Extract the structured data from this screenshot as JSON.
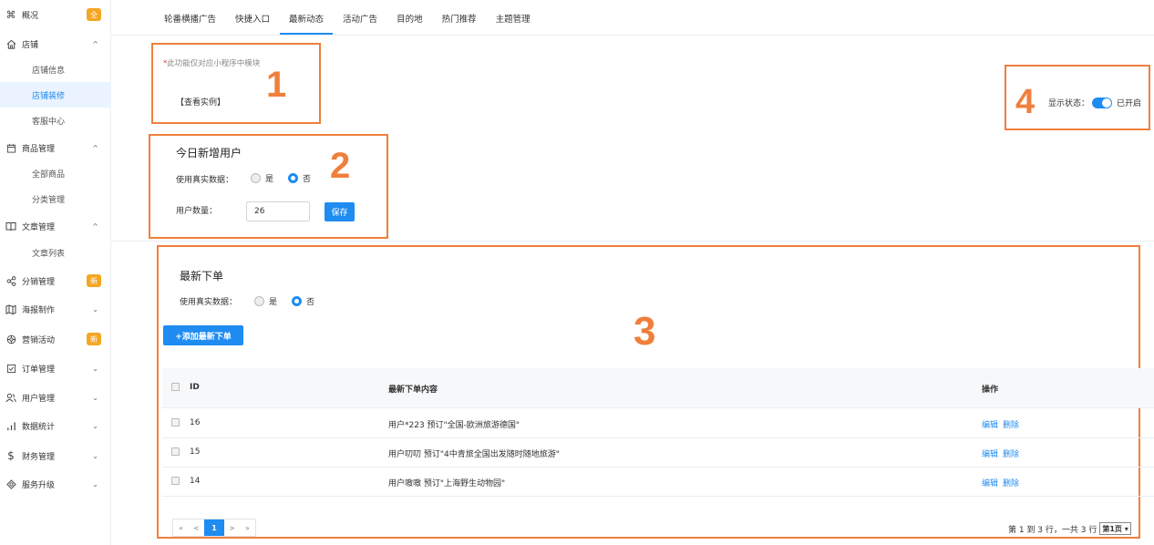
{
  "sidebar": {
    "items": [
      {
        "label": "概况",
        "badge": "全"
      },
      {
        "label": "店铺"
      },
      {
        "label": "商品管理"
      },
      {
        "label": "文章管理"
      },
      {
        "label": "分销管理",
        "badge": "新"
      },
      {
        "label": "海报制作"
      },
      {
        "label": "营销活动",
        "badge": "新"
      },
      {
        "label": "订单管理"
      },
      {
        "label": "用户管理"
      },
      {
        "label": "数据统计"
      },
      {
        "label": "财务管理"
      },
      {
        "label": "服务升级"
      }
    ],
    "sub_shop": [
      "店铺信息",
      "店铺装修",
      "客服中心"
    ],
    "sub_goods": [
      "全部商品",
      "分类管理"
    ],
    "sub_article": [
      "文章列表"
    ]
  },
  "tabs": [
    "轮番横播广告",
    "快捷入口",
    "最新动态",
    "活动广告",
    "目的地",
    "热门推荐",
    "主题管理"
  ],
  "notice": {
    "star": "*",
    "text": "此功能仅对应小程序中模块",
    "example": "【查看实例】"
  },
  "status": {
    "label": "显示状态：",
    "value": "已开启"
  },
  "annotations": [
    "1",
    "2",
    "3",
    "4"
  ],
  "new_users": {
    "title": "今日新增用户",
    "real_label": "使用真实数据：",
    "yes": "是",
    "no": "否",
    "count_label": "用户数量：",
    "count_value": "26",
    "save": "保存"
  },
  "latest_orders": {
    "title": "最新下单",
    "real_label": "使用真实数据：",
    "yes": "是",
    "no": "否",
    "add_button": "+添加最新下单",
    "columns": [
      "ID",
      "最新下单内容",
      "操作"
    ],
    "rows": [
      {
        "id": "16",
        "content": "用户*223 预订\"全国-欧洲旅游德国\"",
        "edit": "编辑",
        "del": "删除"
      },
      {
        "id": "15",
        "content": "用户叨叨 预订\"4中青旅全国出发随时随地旅游\"",
        "edit": "编辑",
        "del": "删除"
      },
      {
        "id": "14",
        "content": "用户嗷嗷 预订\"上海野生动物园\"",
        "edit": "编辑",
        "del": "删除"
      }
    ]
  },
  "pagination": {
    "first": "«",
    "prev": "<",
    "page": "1",
    "next": ">",
    "last": "»",
    "info": "第 1 到 3 行，一共 3 行",
    "select": "第1页 ▾"
  },
  "colors": {
    "accent": "#1e8cf0",
    "annotation": "#f07f3c",
    "badge": "#f5a623"
  }
}
